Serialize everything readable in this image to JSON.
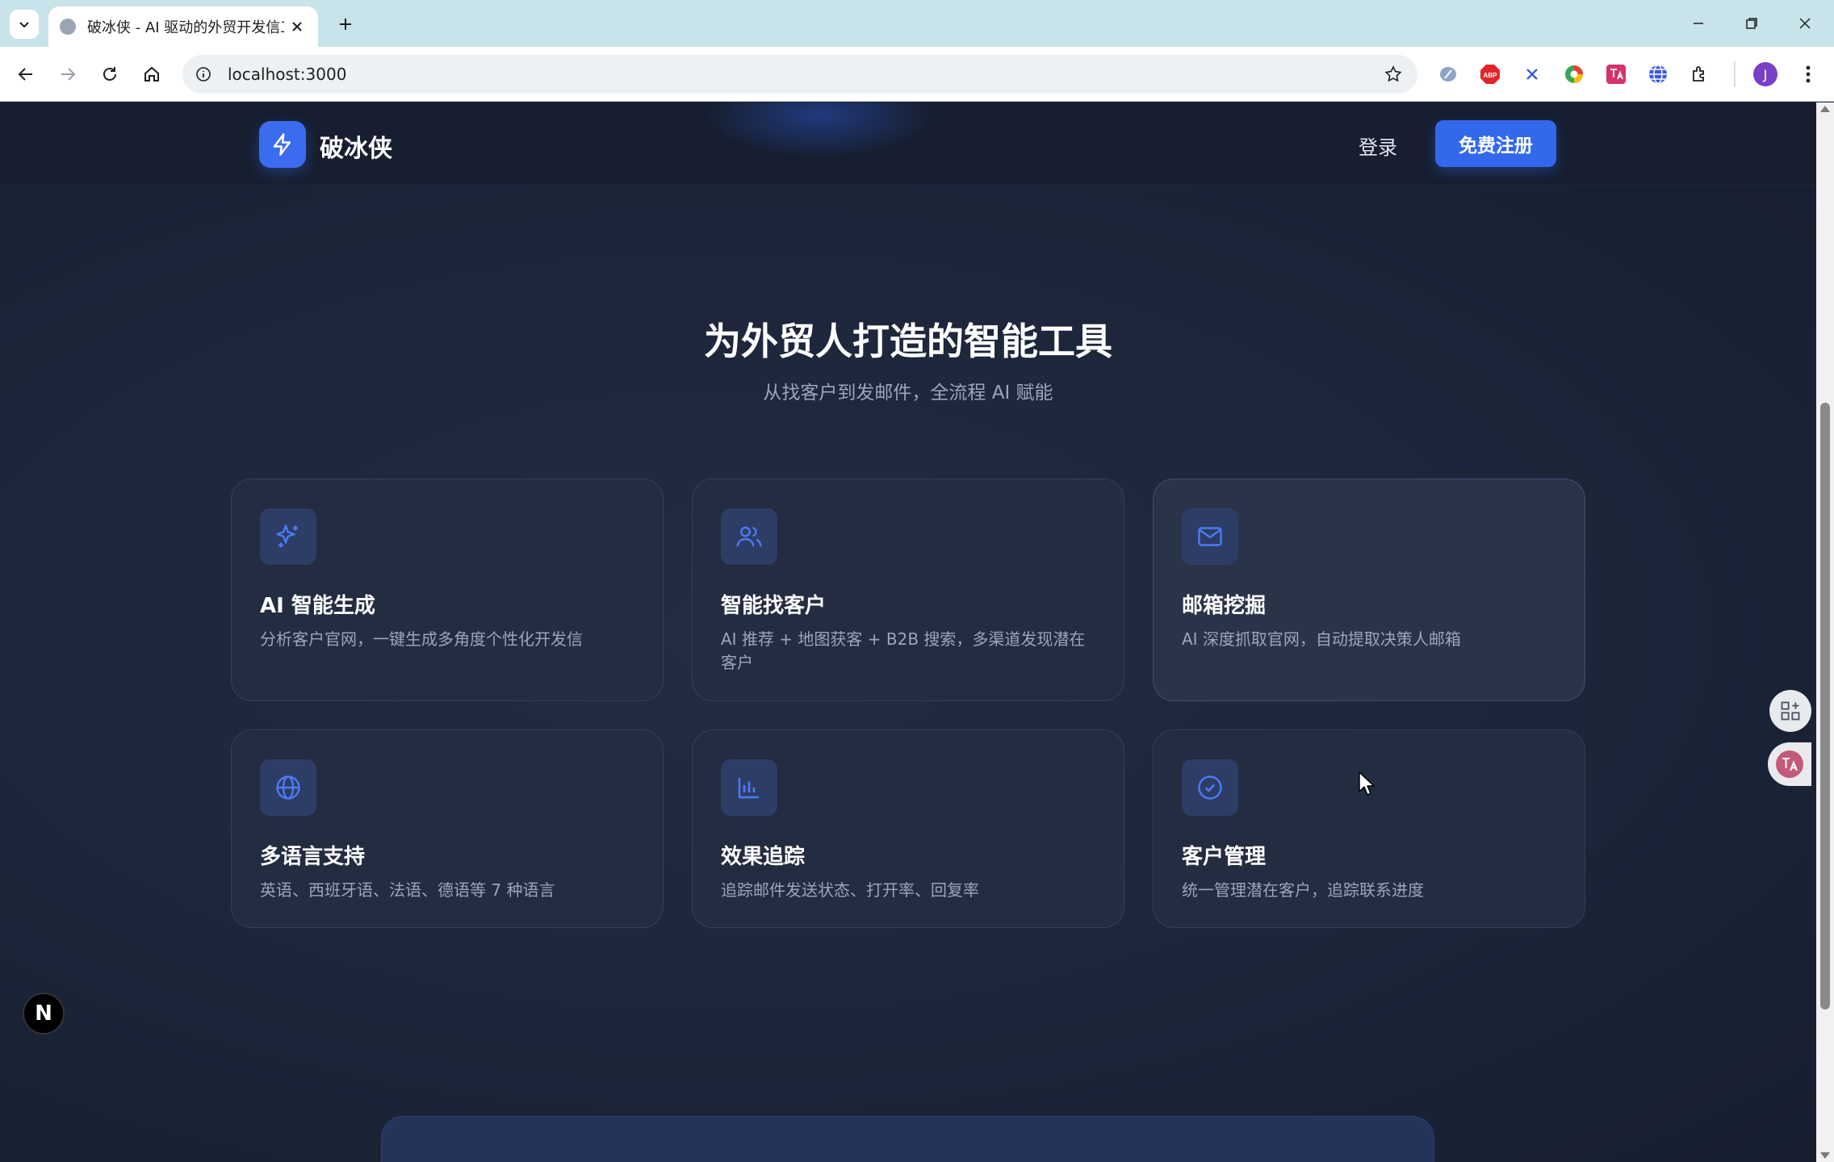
{
  "browser": {
    "tab_title": "破冰侠 - AI 驱动的外贸开发信工",
    "url": "localhost:3000",
    "profile_initial": "J"
  },
  "header": {
    "logo_text": "破冰侠",
    "login_label": "登录",
    "signup_label": "免费注册"
  },
  "section": {
    "title": "为外贸人打造的智能工具",
    "subtitle": "从找客户到发邮件，全流程 AI 赋能"
  },
  "features": [
    {
      "icon": "sparkles-icon",
      "title": "AI 智能生成",
      "desc": "分析客户官网，一键生成多角度个性化开发信"
    },
    {
      "icon": "users-icon",
      "title": "智能找客户",
      "desc": "AI 推荐 + 地图获客 + B2B 搜索，多渠道发现潜在客户"
    },
    {
      "icon": "mail-icon",
      "title": "邮箱挖掘",
      "desc": "AI 深度抓取官网，自动提取决策人邮箱"
    },
    {
      "icon": "globe-icon",
      "title": "多语言支持",
      "desc": "英语、西班牙语、法语、德语等 7 种语言"
    },
    {
      "icon": "bar-chart-icon",
      "title": "效果追踪",
      "desc": "追踪邮件发送状态、打开率、回复率"
    },
    {
      "icon": "check-circle-icon",
      "title": "客户管理",
      "desc": "统一管理潜在客户，追踪联系进度"
    }
  ],
  "dev_badge": "N",
  "colors": {
    "accent": "#3268eb",
    "page_bg": "#1c2539",
    "card_bg": "#232c40",
    "icon_color": "#4b7cf5"
  }
}
